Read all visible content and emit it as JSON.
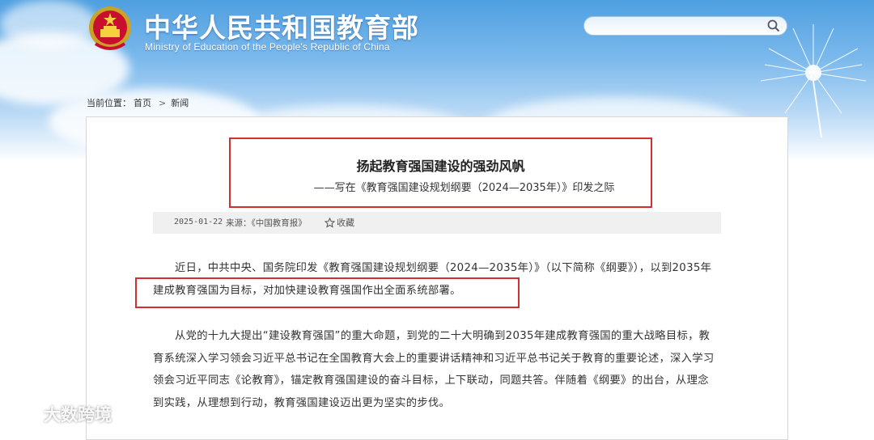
{
  "header": {
    "title_cn": "中华人民共和国教育部",
    "title_en": "Ministry of Education of the People's Republic of China",
    "search_placeholder": ""
  },
  "breadcrumb": {
    "label": "当前位置：",
    "items": [
      "首页",
      "新闻"
    ],
    "separator": ">"
  },
  "article": {
    "title": "扬起教育强国建设的强劲风帆",
    "subtitle": "——写在《教育强国建设规划纲要（2024—2035年）》印发之际",
    "date": "2025-01-22",
    "source": "来源：《中国教育报》",
    "favorite_label": "收藏",
    "paragraphs": [
      "近日，中共中央、国务院印发《教育强国建设规划纲要（2024—2035年）》（以下简称《纲要》），以到2035年建成教育强国为目标，对加快建设教育强国作出全面系统部署。",
      "从党的十九大提出“建设教育强国”的重大命题，到党的二十大明确到2035年建成教育强国的重大战略目标，教育系统深入学习领会习近平总书记在全国教育大会上的重要讲话精神和习近平总书记关于教育的重要论述，深入学习领会习近平同志《论教育》，锚定教育强国建设的奋斗目标，上下联动，同题共答。伴随着《纲要》的出台，从理念到实践，从理想到行动，教育强国建设迈出更为坚实的步伐。"
    ]
  },
  "watermark": {
    "text": "大数跨境"
  },
  "colors": {
    "highlight_red": "#d32f2f",
    "sky_blue": "#4f9fe0"
  }
}
